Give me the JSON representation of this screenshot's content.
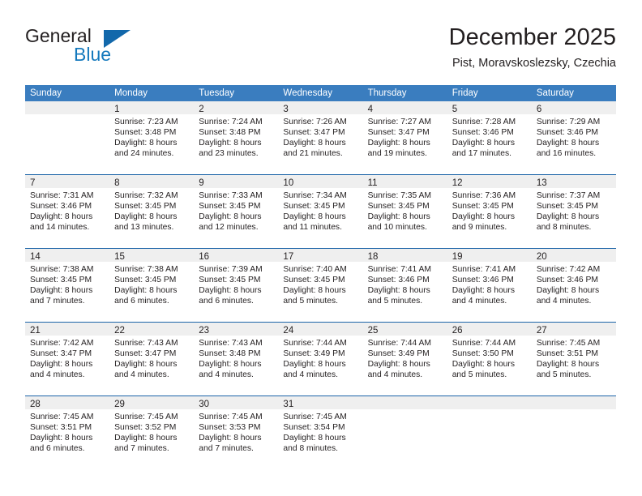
{
  "brand": {
    "name_part1": "General",
    "name_part2": "Blue",
    "triangle_color": "#1268ab",
    "blue_color": "#1579bd"
  },
  "header": {
    "month_title": "December 2025",
    "location": "Pist, Moravskoslezsky, Czechia"
  },
  "theme": {
    "header_blue": "#3a7dbf",
    "row_divider_blue": "#1b64a8",
    "day_band_gray": "#efefef",
    "text": "#231f20"
  },
  "weekdays": [
    "Sunday",
    "Monday",
    "Tuesday",
    "Wednesday",
    "Thursday",
    "Friday",
    "Saturday"
  ],
  "weeks": [
    [
      {
        "day": "",
        "lines": []
      },
      {
        "day": "1",
        "lines": [
          "Sunrise: 7:23 AM",
          "Sunset: 3:48 PM",
          "Daylight: 8 hours",
          "and 24 minutes."
        ]
      },
      {
        "day": "2",
        "lines": [
          "Sunrise: 7:24 AM",
          "Sunset: 3:48 PM",
          "Daylight: 8 hours",
          "and 23 minutes."
        ]
      },
      {
        "day": "3",
        "lines": [
          "Sunrise: 7:26 AM",
          "Sunset: 3:47 PM",
          "Daylight: 8 hours",
          "and 21 minutes."
        ]
      },
      {
        "day": "4",
        "lines": [
          "Sunrise: 7:27 AM",
          "Sunset: 3:47 PM",
          "Daylight: 8 hours",
          "and 19 minutes."
        ]
      },
      {
        "day": "5",
        "lines": [
          "Sunrise: 7:28 AM",
          "Sunset: 3:46 PM",
          "Daylight: 8 hours",
          "and 17 minutes."
        ]
      },
      {
        "day": "6",
        "lines": [
          "Sunrise: 7:29 AM",
          "Sunset: 3:46 PM",
          "Daylight: 8 hours",
          "and 16 minutes."
        ]
      }
    ],
    [
      {
        "day": "7",
        "lines": [
          "Sunrise: 7:31 AM",
          "Sunset: 3:46 PM",
          "Daylight: 8 hours",
          "and 14 minutes."
        ]
      },
      {
        "day": "8",
        "lines": [
          "Sunrise: 7:32 AM",
          "Sunset: 3:45 PM",
          "Daylight: 8 hours",
          "and 13 minutes."
        ]
      },
      {
        "day": "9",
        "lines": [
          "Sunrise: 7:33 AM",
          "Sunset: 3:45 PM",
          "Daylight: 8 hours",
          "and 12 minutes."
        ]
      },
      {
        "day": "10",
        "lines": [
          "Sunrise: 7:34 AM",
          "Sunset: 3:45 PM",
          "Daylight: 8 hours",
          "and 11 minutes."
        ]
      },
      {
        "day": "11",
        "lines": [
          "Sunrise: 7:35 AM",
          "Sunset: 3:45 PM",
          "Daylight: 8 hours",
          "and 10 minutes."
        ]
      },
      {
        "day": "12",
        "lines": [
          "Sunrise: 7:36 AM",
          "Sunset: 3:45 PM",
          "Daylight: 8 hours",
          "and 9 minutes."
        ]
      },
      {
        "day": "13",
        "lines": [
          "Sunrise: 7:37 AM",
          "Sunset: 3:45 PM",
          "Daylight: 8 hours",
          "and 8 minutes."
        ]
      }
    ],
    [
      {
        "day": "14",
        "lines": [
          "Sunrise: 7:38 AM",
          "Sunset: 3:45 PM",
          "Daylight: 8 hours",
          "and 7 minutes."
        ]
      },
      {
        "day": "15",
        "lines": [
          "Sunrise: 7:38 AM",
          "Sunset: 3:45 PM",
          "Daylight: 8 hours",
          "and 6 minutes."
        ]
      },
      {
        "day": "16",
        "lines": [
          "Sunrise: 7:39 AM",
          "Sunset: 3:45 PM",
          "Daylight: 8 hours",
          "and 6 minutes."
        ]
      },
      {
        "day": "17",
        "lines": [
          "Sunrise: 7:40 AM",
          "Sunset: 3:45 PM",
          "Daylight: 8 hours",
          "and 5 minutes."
        ]
      },
      {
        "day": "18",
        "lines": [
          "Sunrise: 7:41 AM",
          "Sunset: 3:46 PM",
          "Daylight: 8 hours",
          "and 5 minutes."
        ]
      },
      {
        "day": "19",
        "lines": [
          "Sunrise: 7:41 AM",
          "Sunset: 3:46 PM",
          "Daylight: 8 hours",
          "and 4 minutes."
        ]
      },
      {
        "day": "20",
        "lines": [
          "Sunrise: 7:42 AM",
          "Sunset: 3:46 PM",
          "Daylight: 8 hours",
          "and 4 minutes."
        ]
      }
    ],
    [
      {
        "day": "21",
        "lines": [
          "Sunrise: 7:42 AM",
          "Sunset: 3:47 PM",
          "Daylight: 8 hours",
          "and 4 minutes."
        ]
      },
      {
        "day": "22",
        "lines": [
          "Sunrise: 7:43 AM",
          "Sunset: 3:47 PM",
          "Daylight: 8 hours",
          "and 4 minutes."
        ]
      },
      {
        "day": "23",
        "lines": [
          "Sunrise: 7:43 AM",
          "Sunset: 3:48 PM",
          "Daylight: 8 hours",
          "and 4 minutes."
        ]
      },
      {
        "day": "24",
        "lines": [
          "Sunrise: 7:44 AM",
          "Sunset: 3:49 PM",
          "Daylight: 8 hours",
          "and 4 minutes."
        ]
      },
      {
        "day": "25",
        "lines": [
          "Sunrise: 7:44 AM",
          "Sunset: 3:49 PM",
          "Daylight: 8 hours",
          "and 4 minutes."
        ]
      },
      {
        "day": "26",
        "lines": [
          "Sunrise: 7:44 AM",
          "Sunset: 3:50 PM",
          "Daylight: 8 hours",
          "and 5 minutes."
        ]
      },
      {
        "day": "27",
        "lines": [
          "Sunrise: 7:45 AM",
          "Sunset: 3:51 PM",
          "Daylight: 8 hours",
          "and 5 minutes."
        ]
      }
    ],
    [
      {
        "day": "28",
        "lines": [
          "Sunrise: 7:45 AM",
          "Sunset: 3:51 PM",
          "Daylight: 8 hours",
          "and 6 minutes."
        ]
      },
      {
        "day": "29",
        "lines": [
          "Sunrise: 7:45 AM",
          "Sunset: 3:52 PM",
          "Daylight: 8 hours",
          "and 7 minutes."
        ]
      },
      {
        "day": "30",
        "lines": [
          "Sunrise: 7:45 AM",
          "Sunset: 3:53 PM",
          "Daylight: 8 hours",
          "and 7 minutes."
        ]
      },
      {
        "day": "31",
        "lines": [
          "Sunrise: 7:45 AM",
          "Sunset: 3:54 PM",
          "Daylight: 8 hours",
          "and 8 minutes."
        ]
      },
      {
        "day": "",
        "lines": []
      },
      {
        "day": "",
        "lines": []
      },
      {
        "day": "",
        "lines": []
      }
    ]
  ]
}
